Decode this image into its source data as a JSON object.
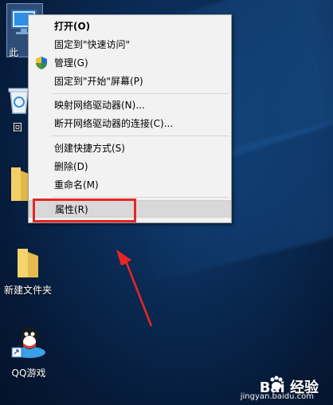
{
  "desktop": {
    "icons": [
      {
        "label": "此"
      },
      {
        "label": "回"
      },
      {
        "label": "新建文件夹"
      },
      {
        "label": "QQ游戏"
      }
    ]
  },
  "context_menu": {
    "items": [
      {
        "label": "打开(O)",
        "bold": true
      },
      {
        "label": "固定到\"快速访问\""
      },
      {
        "label": "管理(G)",
        "icon": "shield-icon"
      },
      {
        "label": "固定到\"开始\"屏幕(P)"
      },
      {
        "label": "映射网络驱动器(N)..."
      },
      {
        "label": "断开网络驱动器的连接(C)..."
      },
      {
        "label": "创建快捷方式(S)"
      },
      {
        "label": "删除(D)"
      },
      {
        "label": "重命名(M)"
      },
      {
        "label": "属性(R)",
        "highlighted": true
      }
    ]
  },
  "colors": {
    "highlight_box": "#e52626",
    "annotation_arrow": "#e52626"
  },
  "watermark": {
    "brand": "Bai 经验",
    "url": "jingyan.baidu.com"
  }
}
